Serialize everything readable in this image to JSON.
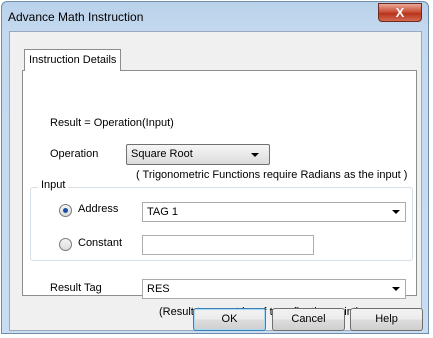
{
  "window": {
    "title": "Advance Math Instruction",
    "close_glyph": "X"
  },
  "tab": {
    "label": "Instruction Details"
  },
  "formula": "Result = Operation(Input)",
  "operation": {
    "label": "Operation",
    "selected": "Square Root",
    "note": "( Trigonometric Functions require Radians as the input )"
  },
  "input_group": {
    "label": "Input",
    "address_label": "Address",
    "address_value": "TAG 1",
    "address_checked": true,
    "constant_label": "Constant",
    "constant_value": ""
  },
  "result": {
    "label": "Result Tag",
    "value": "RES",
    "note": "(Result tag must be of type floating point)"
  },
  "buttons": {
    "ok": "OK",
    "cancel": "Cancel",
    "help": "Help"
  }
}
